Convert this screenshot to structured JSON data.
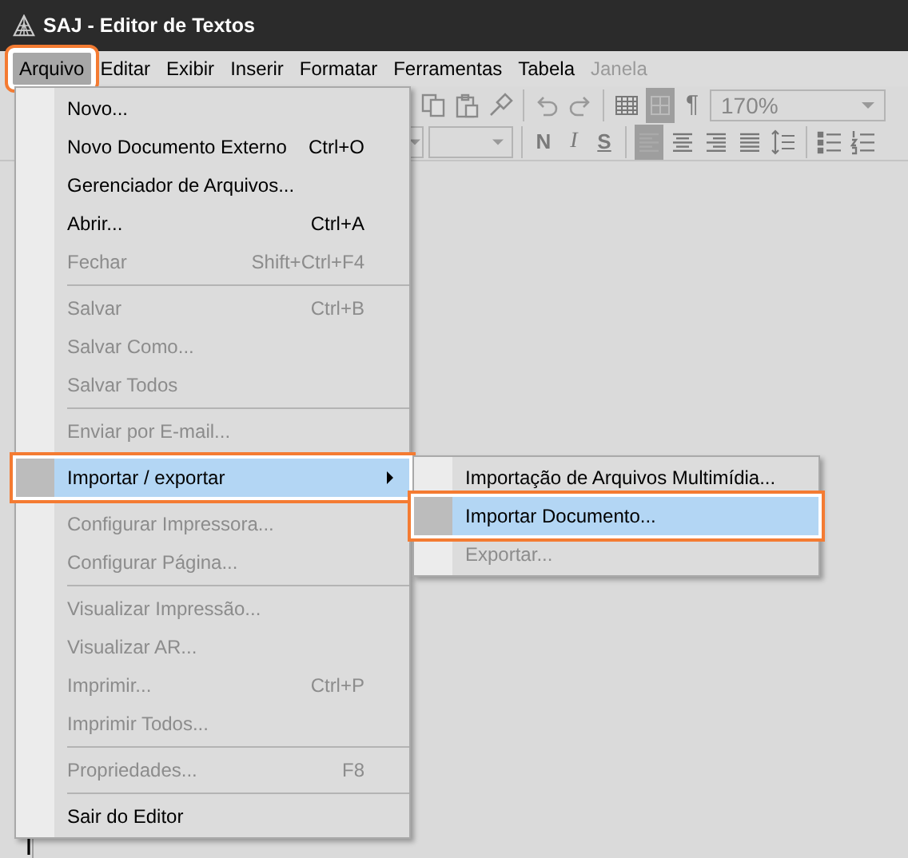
{
  "window": {
    "title": "SAJ - Editor de Textos"
  },
  "menubar": [
    {
      "label": "Arquivo",
      "selected": true,
      "highlighted": true,
      "disabled": false
    },
    {
      "label": "Editar",
      "selected": false,
      "highlighted": false,
      "disabled": false
    },
    {
      "label": "Exibir",
      "selected": false,
      "highlighted": false,
      "disabled": false
    },
    {
      "label": "Inserir",
      "selected": false,
      "highlighted": false,
      "disabled": false
    },
    {
      "label": "Formatar",
      "selected": false,
      "highlighted": false,
      "disabled": false
    },
    {
      "label": "Ferramentas",
      "selected": false,
      "highlighted": false,
      "disabled": false
    },
    {
      "label": "Tabela",
      "selected": false,
      "highlighted": false,
      "disabled": false
    },
    {
      "label": "Janela",
      "selected": false,
      "highlighted": false,
      "disabled": true
    }
  ],
  "toolbar_rows": [
    [
      {
        "kind": "copy",
        "selected": false
      },
      {
        "kind": "paste",
        "selected": false
      },
      {
        "kind": "brush",
        "selected": false
      },
      {
        "kind": "sep"
      },
      {
        "kind": "undo",
        "selected": false
      },
      {
        "kind": "redo",
        "selected": false
      },
      {
        "kind": "sep"
      },
      {
        "kind": "table",
        "selected": false
      },
      {
        "kind": "grid",
        "selected": true
      },
      {
        "kind": "text",
        "label": "¶",
        "selected": false
      },
      {
        "kind": "combo",
        "value": "170%"
      }
    ],
    [
      {
        "kind": "dropdown"
      },
      {
        "kind": "sep"
      },
      {
        "kind": "bold",
        "label": "N",
        "selected": false
      },
      {
        "kind": "italic",
        "label": "I",
        "selected": false
      },
      {
        "kind": "underline",
        "label": "S",
        "selected": false
      },
      {
        "kind": "sep"
      },
      {
        "kind": "align-left",
        "selected": true
      },
      {
        "kind": "align-center",
        "selected": false
      },
      {
        "kind": "align-right",
        "selected": false
      },
      {
        "kind": "justify",
        "selected": false
      },
      {
        "kind": "spacing",
        "selected": false
      },
      {
        "kind": "sep"
      },
      {
        "kind": "bullets",
        "selected": false
      },
      {
        "kind": "numbers",
        "selected": false
      }
    ]
  ],
  "file_menu": [
    {
      "kind": "item",
      "label": "Novo...",
      "disabled": false,
      "selected": false,
      "highlighted": false,
      "submenu": false
    },
    {
      "kind": "item",
      "label": "Novo Documento Externo",
      "shortcut": "Ctrl+O",
      "disabled": false,
      "selected": false,
      "highlighted": false,
      "submenu": false
    },
    {
      "kind": "item",
      "label": "Gerenciador de Arquivos...",
      "disabled": false,
      "selected": false,
      "highlighted": false,
      "submenu": false
    },
    {
      "kind": "item",
      "label": "Abrir...",
      "shortcut": "Ctrl+A",
      "disabled": false,
      "selected": false,
      "highlighted": false,
      "submenu": false
    },
    {
      "kind": "item",
      "label": "Fechar",
      "shortcut": "Shift+Ctrl+F4",
      "disabled": true,
      "selected": false,
      "highlighted": false,
      "submenu": false
    },
    {
      "kind": "separator"
    },
    {
      "kind": "item",
      "label": "Salvar",
      "shortcut": "Ctrl+B",
      "disabled": true,
      "selected": false,
      "highlighted": false,
      "submenu": false
    },
    {
      "kind": "item",
      "label": "Salvar Como...",
      "disabled": true,
      "selected": false,
      "highlighted": false,
      "submenu": false
    },
    {
      "kind": "item",
      "label": "Salvar Todos",
      "disabled": true,
      "selected": false,
      "highlighted": false,
      "submenu": false
    },
    {
      "kind": "separator"
    },
    {
      "kind": "item",
      "label": "Enviar por E-mail...",
      "disabled": true,
      "selected": false,
      "highlighted": false,
      "submenu": false
    },
    {
      "kind": "separator"
    },
    {
      "kind": "item",
      "label": "Importar / exportar",
      "disabled": false,
      "selected": true,
      "highlighted": true,
      "submenu": true
    },
    {
      "kind": "separator"
    },
    {
      "kind": "item",
      "label": "Configurar Impressora...",
      "disabled": true,
      "selected": false,
      "highlighted": false,
      "submenu": false
    },
    {
      "kind": "item",
      "label": "Configurar Página...",
      "disabled": true,
      "selected": false,
      "highlighted": false,
      "submenu": false
    },
    {
      "kind": "separator"
    },
    {
      "kind": "item",
      "label": "Visualizar Impressão...",
      "disabled": true,
      "selected": false,
      "highlighted": false,
      "submenu": false
    },
    {
      "kind": "item",
      "label": "Visualizar AR...",
      "disabled": true,
      "selected": false,
      "highlighted": false,
      "submenu": false
    },
    {
      "kind": "item",
      "label": "Imprimir...",
      "shortcut": "Ctrl+P",
      "disabled": true,
      "selected": false,
      "highlighted": false,
      "submenu": false
    },
    {
      "kind": "item",
      "label": "Imprimir Todos...",
      "disabled": true,
      "selected": false,
      "highlighted": false,
      "submenu": false
    },
    {
      "kind": "separator"
    },
    {
      "kind": "item",
      "label": "Propriedades...",
      "shortcut": "F8",
      "disabled": true,
      "selected": false,
      "highlighted": false,
      "submenu": false
    },
    {
      "kind": "separator"
    },
    {
      "kind": "item",
      "label": "Sair do Editor",
      "disabled": false,
      "selected": false,
      "highlighted": false,
      "submenu": false
    }
  ],
  "submenu": [
    {
      "label": "Importação de Arquivos Multimídia...",
      "disabled": false,
      "selected": false,
      "highlighted": false
    },
    {
      "label": "Importar Documento...",
      "disabled": false,
      "selected": true,
      "highlighted": true
    },
    {
      "label": "Exportar...",
      "disabled": true,
      "selected": false,
      "highlighted": false
    }
  ]
}
